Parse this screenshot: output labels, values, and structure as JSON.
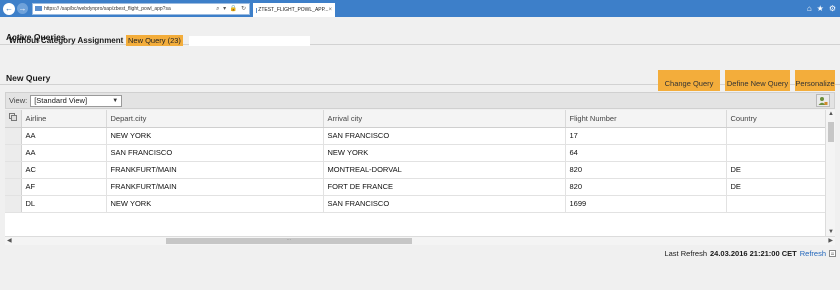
{
  "browser": {
    "address": "https://                              /sap/bc/webdynpro/sap/zbest_flight_powl_app?sa",
    "tab_label": "ZTEST_FLIGHT_POWL_APP...",
    "address_icons": "⌕ ▾ 🔒 ↻"
  },
  "active_queries": {
    "title": "Active Queries",
    "label": "Without Category Assignment",
    "query_link": "New Query (23)"
  },
  "new_query": {
    "title": "New Query",
    "buttons": {
      "change": "Change Query",
      "define": "Define New Query",
      "personalize": "Personalize"
    }
  },
  "view": {
    "label": "View:",
    "selected": "[Standard View]"
  },
  "table": {
    "columns": [
      "Airline",
      "Depart.city",
      "Arrival city",
      "Flight Number",
      "Country"
    ],
    "rows": [
      [
        "AA",
        "NEW YORK",
        "SAN FRANCISCO",
        "17",
        ""
      ],
      [
        "AA",
        "SAN FRANCISCO",
        "NEW YORK",
        "64",
        ""
      ],
      [
        "AC",
        "FRANKFURT/MAIN",
        "MONTREAL-DORVAL",
        "820",
        "DE"
      ],
      [
        "AF",
        "FRANKFURT/MAIN",
        "FORT DE FRANCE",
        "820",
        "DE"
      ],
      [
        "DL",
        "NEW YORK",
        "SAN FRANCISCO",
        "1699",
        ""
      ]
    ]
  },
  "footer": {
    "last_refresh_label": "Last Refresh",
    "timestamp": "24.03.2016 21:21:00 CET",
    "refresh_link": "Refresh"
  },
  "colors": {
    "accent_orange": "#f3ad3b",
    "browser_blue": "#3d7fc9"
  }
}
